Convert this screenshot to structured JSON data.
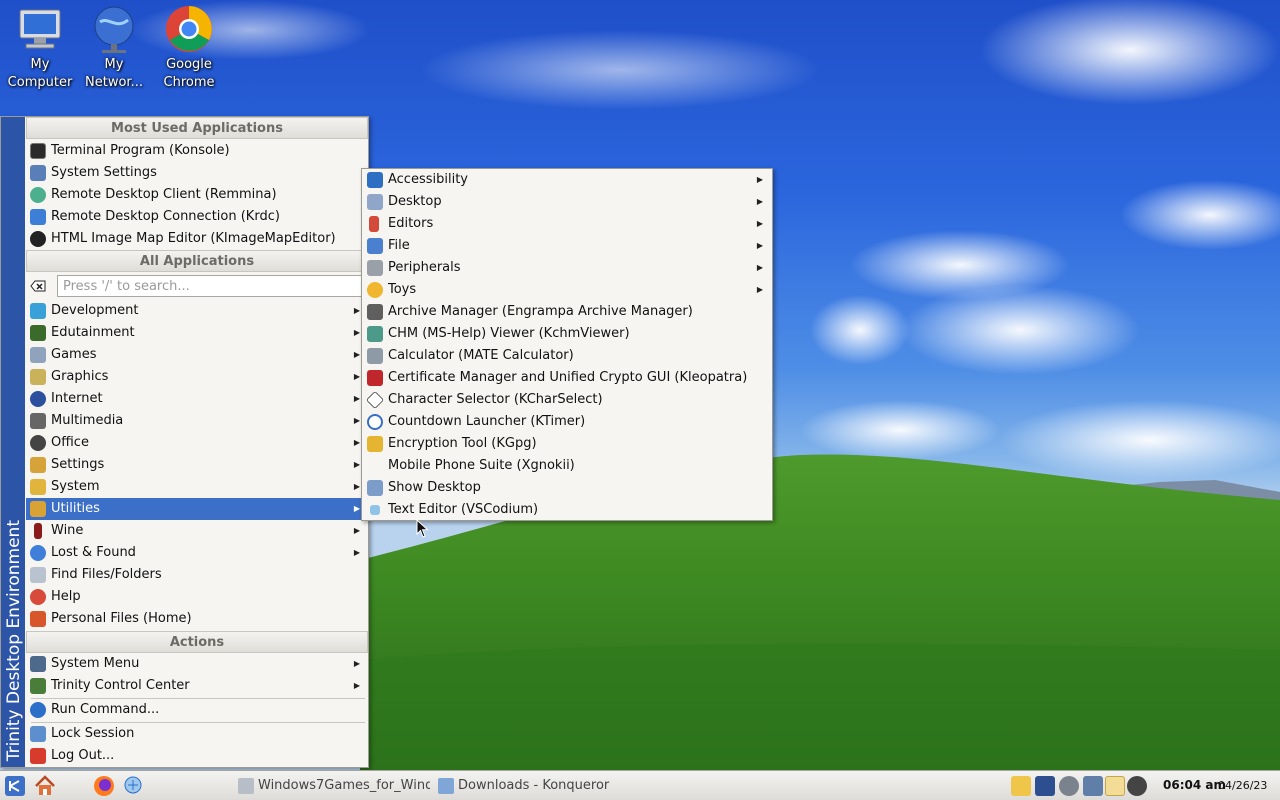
{
  "desktop": {
    "icons": [
      {
        "label": "My Computer"
      },
      {
        "label": "My Networ..."
      },
      {
        "label": "Google Chrome"
      }
    ]
  },
  "kmenu": {
    "sidebar_title": "Trinity Desktop Environment",
    "most_used_header": "Most Used Applications",
    "most_used": [
      {
        "label": "Terminal Program (Konsole)",
        "icon": "terminal-icon"
      },
      {
        "label": "System Settings",
        "icon": "system-settings-icon"
      },
      {
        "label": "Remote Desktop Client (Remmina)",
        "icon": "remmina-icon"
      },
      {
        "label": "Remote Desktop Connection (Krdc)",
        "icon": "krdc-icon"
      },
      {
        "label": "HTML Image Map Editor (KImageMapEditor)",
        "icon": "imagemap-icon"
      }
    ],
    "all_apps_header": "All Applications",
    "search_placeholder": "Press '/' to search...",
    "categories": [
      {
        "label": "Development",
        "icon": "development-icon",
        "submenu": true
      },
      {
        "label": "Edutainment",
        "icon": "edutainment-icon",
        "submenu": true
      },
      {
        "label": "Games",
        "icon": "games-icon",
        "submenu": true
      },
      {
        "label": "Graphics",
        "icon": "graphics-icon",
        "submenu": true
      },
      {
        "label": "Internet",
        "icon": "internet-icon",
        "submenu": true
      },
      {
        "label": "Multimedia",
        "icon": "multimedia-icon",
        "submenu": true
      },
      {
        "label": "Office",
        "icon": "office-icon",
        "submenu": true
      },
      {
        "label": "Settings",
        "icon": "settings-icon",
        "submenu": true
      },
      {
        "label": "System",
        "icon": "system-icon",
        "submenu": true
      },
      {
        "label": "Utilities",
        "icon": "utilities-icon",
        "submenu": true,
        "active": true
      },
      {
        "label": "Wine",
        "icon": "wine-icon",
        "submenu": true
      },
      {
        "label": "Lost & Found",
        "icon": "lost-found-icon",
        "submenu": true
      },
      {
        "label": "Find Files/Folders",
        "icon": "find-files-icon",
        "submenu": false
      },
      {
        "label": "Help",
        "icon": "help-icon",
        "submenu": false
      },
      {
        "label": "Personal Files (Home)",
        "icon": "home-icon",
        "submenu": false
      }
    ],
    "actions_header": "Actions",
    "actions": [
      {
        "label": "System Menu",
        "icon": "system-menu-icon",
        "submenu": true
      },
      {
        "label": "Trinity Control Center",
        "icon": "control-center-icon",
        "submenu": true
      },
      {
        "label": "Run Command...",
        "icon": "run-command-icon",
        "submenu": false
      },
      {
        "label": "Lock Session",
        "icon": "lock-icon",
        "submenu": false
      },
      {
        "label": "Log Out...",
        "icon": "logout-icon",
        "submenu": false
      }
    ]
  },
  "utilities_submenu": {
    "items": [
      {
        "label": "Accessibility",
        "icon": "accessibility-icon",
        "submenu": true
      },
      {
        "label": "Desktop",
        "icon": "desktop-icon",
        "submenu": true
      },
      {
        "label": "Editors",
        "icon": "editors-icon",
        "submenu": true
      },
      {
        "label": "File",
        "icon": "file-icon",
        "submenu": true
      },
      {
        "label": "Peripherals",
        "icon": "peripherals-icon",
        "submenu": true
      },
      {
        "label": "Toys",
        "icon": "toys-icon",
        "submenu": true
      },
      {
        "label": "Archive Manager (Engrampa Archive Manager)",
        "icon": "archive-icon",
        "submenu": false
      },
      {
        "label": "CHM (MS-Help) Viewer (KchmViewer)",
        "icon": "chm-viewer-icon",
        "submenu": false
      },
      {
        "label": "Calculator (MATE Calculator)",
        "icon": "calculator-icon",
        "submenu": false
      },
      {
        "label": "Certificate Manager and Unified Crypto GUI (Kleopatra)",
        "icon": "kleopatra-icon",
        "submenu": false
      },
      {
        "label": "Character Selector (KCharSelect)",
        "icon": "charselect-icon",
        "submenu": false
      },
      {
        "label": "Countdown Launcher (KTimer)",
        "icon": "timer-icon",
        "submenu": false
      },
      {
        "label": "Encryption Tool (KGpg)",
        "icon": "kgpg-icon",
        "submenu": false
      },
      {
        "label": "Mobile Phone Suite (Xgnokii)",
        "icon": "",
        "submenu": false
      },
      {
        "label": "Show Desktop",
        "icon": "show-desktop-icon",
        "submenu": false
      },
      {
        "label": "Text Editor (VSCodium)",
        "icon": "vscodium-icon",
        "submenu": false
      }
    ]
  },
  "taskbar": {
    "tasks": [
      {
        "label": "Windows7Games_for_Windo"
      },
      {
        "label": "Downloads - Konqueror"
      }
    ],
    "clock_time": "06:04 am",
    "clock_date": "04/26/23"
  },
  "colors": {
    "highlight": "#3c6fc7",
    "sidebar": "#2c55a8",
    "menu_bg": "#f6f5f2"
  }
}
